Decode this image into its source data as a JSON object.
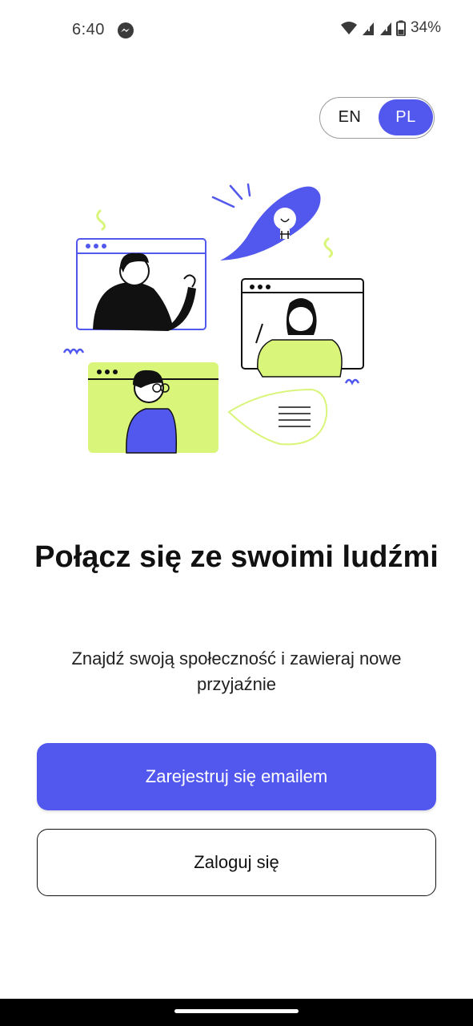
{
  "status_bar": {
    "time": "6:40",
    "battery": "34%",
    "icons": [
      "messenger-icon",
      "wifi-icon",
      "signal-icon",
      "signal-icon",
      "battery-icon"
    ]
  },
  "language_toggle": {
    "options": [
      "EN",
      "PL"
    ],
    "selected": "PL"
  },
  "hero": {
    "title": "Połącz się ze swoimi ludźmi",
    "subtitle": "Znajdź swoją społeczność i zawieraj nowe przyjaźnie"
  },
  "actions": {
    "register_label": "Zarejestruj się emailem",
    "login_label": "Zaloguj się"
  },
  "colors": {
    "accent": "#5258ee",
    "lime": "#d9f57a",
    "text": "#111111"
  }
}
